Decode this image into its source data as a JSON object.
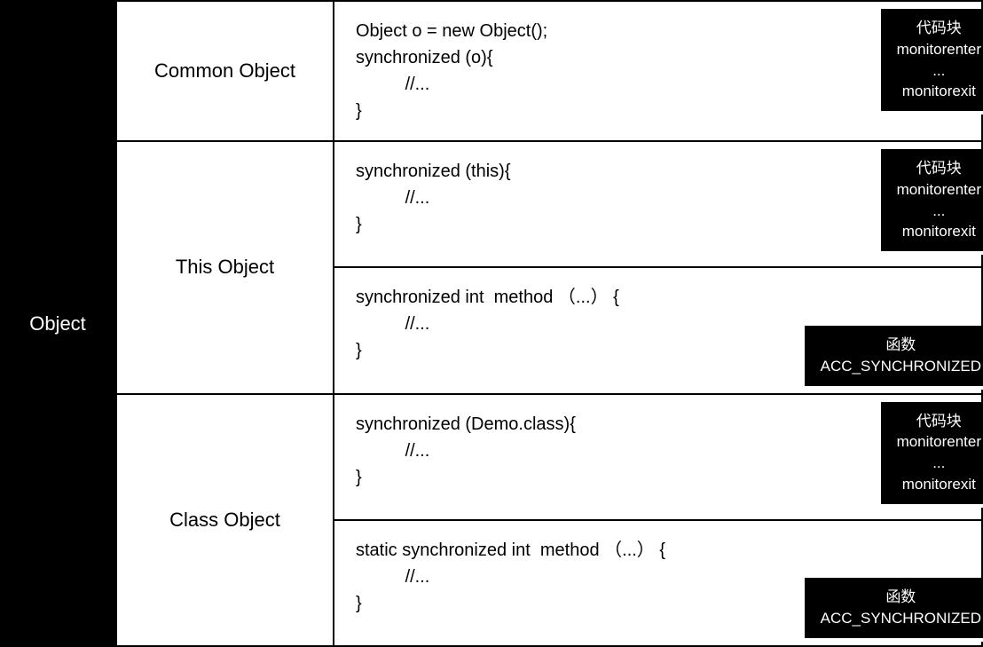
{
  "root": {
    "title": "Object"
  },
  "sections": [
    {
      "label": "Common Object",
      "cells": [
        {
          "code": "Object o = new Object();\nsynchronized (o){\n          //...\n}",
          "badge": "代码块\nmonitorenter\n...\nmonitorexit",
          "badgePos": "top"
        }
      ]
    },
    {
      "label": "This Object",
      "cells": [
        {
          "code": "synchronized (this){\n          //...\n}",
          "badge": "代码块\nmonitorenter\n...\nmonitorexit",
          "badgePos": "top"
        },
        {
          "code": "synchronized int  method （...） {\n          //...\n}",
          "badge": "函数\nACC_SYNCHRONIZED",
          "badgePos": "bottom"
        }
      ]
    },
    {
      "label": "Class Object",
      "cells": [
        {
          "code": "synchronized (Demo.class){\n          //...\n}",
          "badge": "代码块\nmonitorenter\n...\nmonitorexit",
          "badgePos": "top"
        },
        {
          "code": "static synchronized int  method （...） {\n          //...\n}",
          "badge": "函数\nACC_SYNCHRONIZED",
          "badgePos": "bottom"
        }
      ]
    }
  ]
}
